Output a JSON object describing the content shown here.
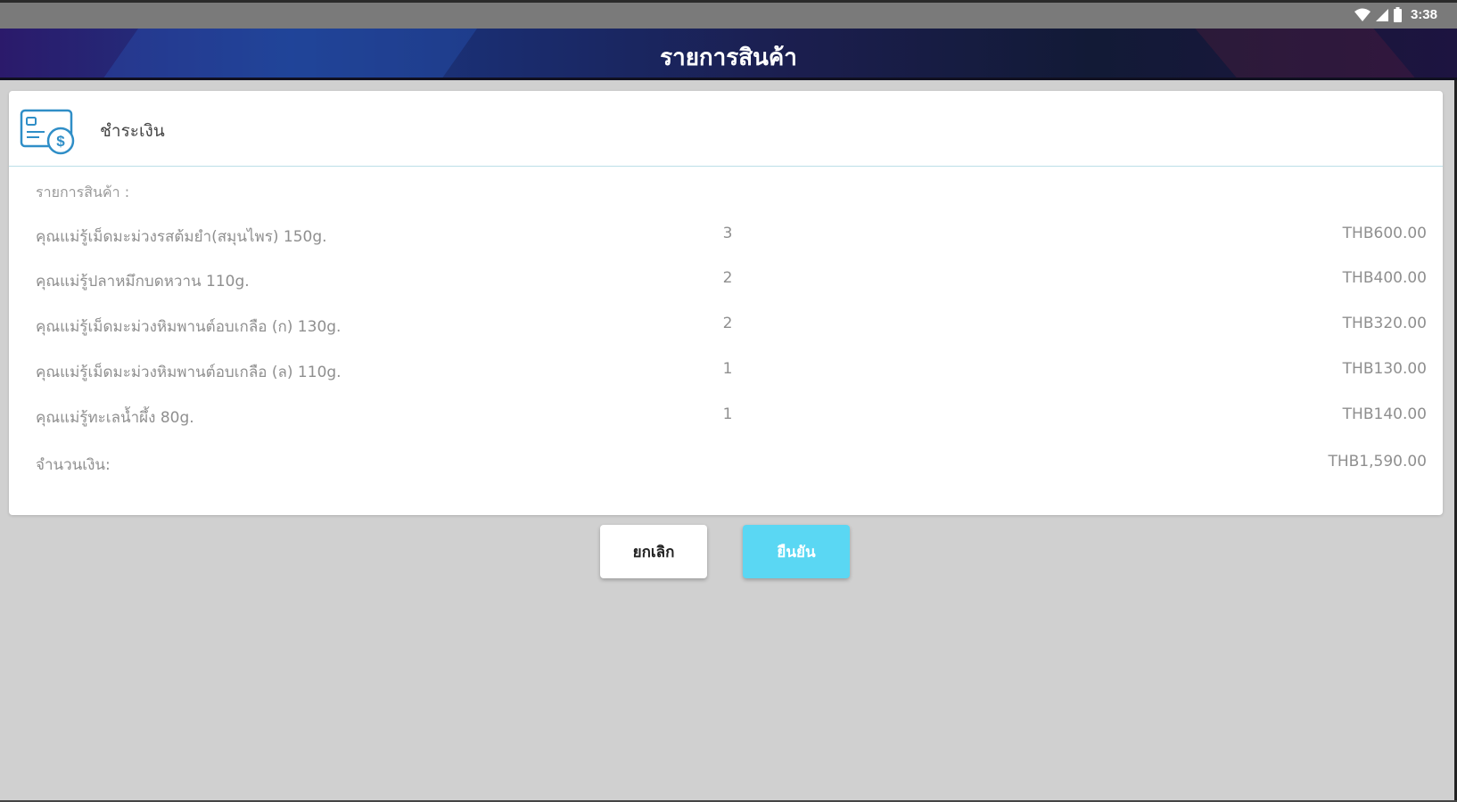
{
  "status_bar": {
    "time": "3:38",
    "icons": [
      "wifi-icon",
      "signal-icon",
      "battery-icon"
    ]
  },
  "app_bar": {
    "title": "รายการสินค้า"
  },
  "card": {
    "title": "ชำระเงิน",
    "icon": "payment-icon",
    "section_label": "รายการสินค้า :",
    "items": [
      {
        "name": "คุณแม่รู้เม็ดมะม่วงรสต้มยำ(สมุนไพร) 150g.",
        "qty": "3",
        "price": "THB600.00"
      },
      {
        "name": "คุณแม่รู้ปลาหมึกบดหวาน 110g.",
        "qty": "2",
        "price": "THB400.00"
      },
      {
        "name": "คุณแม่รู้เม็ดมะม่วงหิมพานต์อบเกลือ (ก) 130g.",
        "qty": "2",
        "price": "THB320.00"
      },
      {
        "name": "คุณแม่รู้เม็ดมะม่วงหิมพานต์อบเกลือ (ล) 110g.",
        "qty": "1",
        "price": "THB130.00"
      },
      {
        "name": "คุณแม่รู้ทะเลน้ำผึ้ง 80g.",
        "qty": "1",
        "price": "THB140.00"
      }
    ],
    "total_label": "จำนวนเงิน:",
    "total_value": "THB1,590.00"
  },
  "buttons": {
    "cancel": "ยกเลิก",
    "confirm": "ยืนยัน"
  },
  "colors": {
    "accent": "#5ad7f3",
    "background": "#d0d0d0"
  }
}
